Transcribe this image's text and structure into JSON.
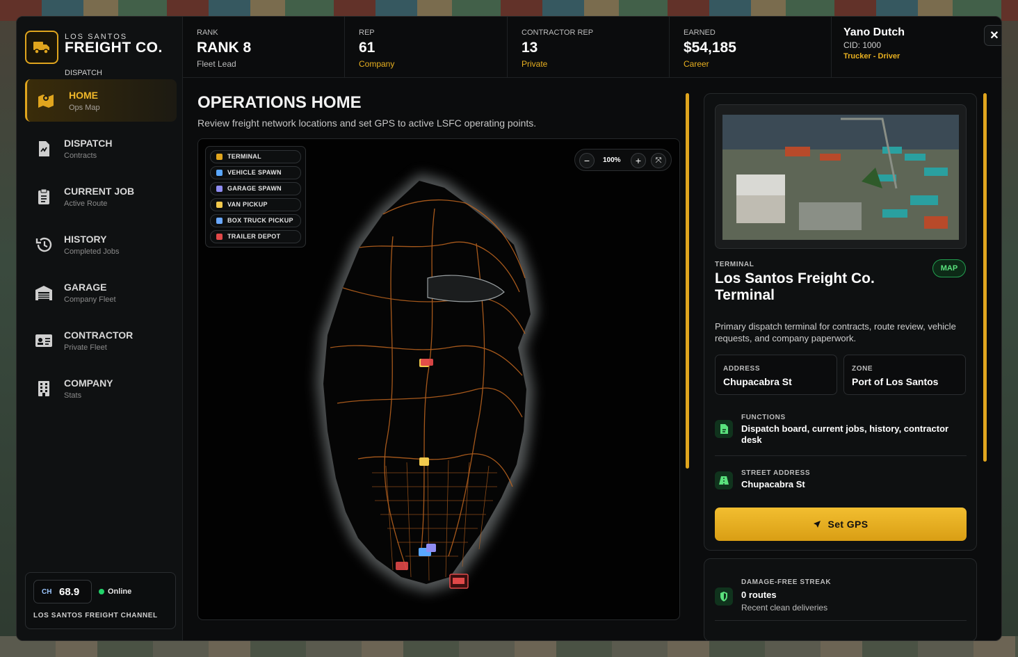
{
  "brand": {
    "small": "LOS SANTOS",
    "big": "FREIGHT CO.",
    "sub": "DISPATCH"
  },
  "nav": [
    {
      "label": "HOME",
      "sub": "Ops Map",
      "icon": "map-icon"
    },
    {
      "label": "DISPATCH",
      "sub": "Contracts",
      "icon": "document-icon"
    },
    {
      "label": "CURRENT JOB",
      "sub": "Active Route",
      "icon": "clipboard-icon"
    },
    {
      "label": "HISTORY",
      "sub": "Completed Jobs",
      "icon": "history-icon"
    },
    {
      "label": "GARAGE",
      "sub": "Company Fleet",
      "icon": "garage-icon"
    },
    {
      "label": "CONTRACTOR",
      "sub": "Private Fleet",
      "icon": "id-card-icon"
    },
    {
      "label": "COMPANY",
      "sub": "Stats",
      "icon": "building-icon"
    }
  ],
  "channel": {
    "tag": "CH",
    "value": "68.9",
    "status": "Online",
    "name": "LOS SANTOS FREIGHT CHANNEL"
  },
  "stats": [
    {
      "label": "RANK",
      "value": "RANK 8",
      "sub": "Fleet Lead",
      "sub_color": "plain"
    },
    {
      "label": "REP",
      "value": "61",
      "sub": "Company",
      "sub_color": "gold"
    },
    {
      "label": "CONTRACTOR REP",
      "value": "13",
      "sub": "Private",
      "sub_color": "gold"
    },
    {
      "label": "EARNED",
      "value": "$54,185",
      "sub": "Career",
      "sub_color": "gold"
    }
  ],
  "user": {
    "name": "Yano Dutch",
    "cid": "CID: 1000",
    "role": "Trucker - Driver"
  },
  "close_label": "✕",
  "page": {
    "title": "OPERATIONS HOME",
    "description": "Review freight network locations and set GPS to active LSFC operating points."
  },
  "legend": [
    {
      "label": "TERMINAL",
      "color": "#e0a51e"
    },
    {
      "label": "VEHICLE SPAWN",
      "color": "#5aa7ff"
    },
    {
      "label": "GARAGE SPAWN",
      "color": "#8f8cf2"
    },
    {
      "label": "VAN PICKUP",
      "color": "#f2c94c"
    },
    {
      "label": "BOX TRUCK PICKUP",
      "color": "#6aa8ff"
    },
    {
      "label": "TRAILER DEPOT",
      "color": "#e04848"
    }
  ],
  "zoom": {
    "minus": "−",
    "level": "100%",
    "plus": "+",
    "fit": "⤧"
  },
  "terminal": {
    "label": "TERMINAL",
    "title": "Los Santos Freight Co. Terminal",
    "badge": "MAP",
    "description": "Primary dispatch terminal for contracts, route review, vehicle requests, and company paperwork.",
    "address_label": "ADDRESS",
    "address": "Chupacabra St",
    "zone_label": "ZONE",
    "zone": "Port of Los Santos",
    "functions_label": "FUNCTIONS",
    "functions": "Dispatch board, current jobs, history, contractor desk",
    "street_label": "STREET ADDRESS",
    "street": "Chupacabra St",
    "gps_button": "Set GPS"
  },
  "streak": {
    "label": "DAMAGE-FREE STREAK",
    "value": "0 routes",
    "sub": "Recent clean deliveries"
  },
  "colors": {
    "accent": "#e0a51e",
    "green": "#5ae27d",
    "map_road": "#b8621e"
  }
}
